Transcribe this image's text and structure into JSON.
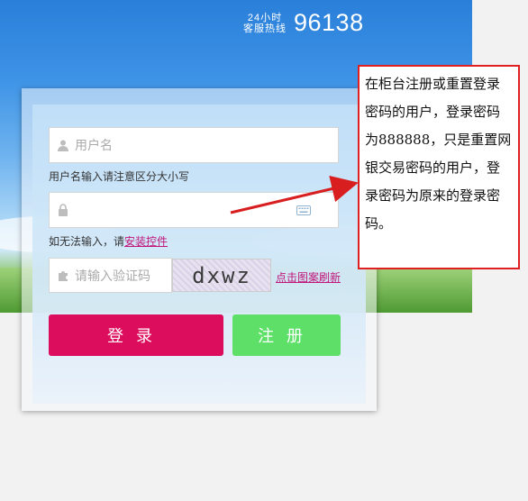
{
  "hotline": {
    "label_line1": "24小时",
    "label_line2": "客服热线",
    "number": "96138"
  },
  "form": {
    "username_placeholder": "用户名",
    "username_hint": "用户名输入请注意区分大小写",
    "password_placeholder": "",
    "password_hint_prefix": "如无法输入，请",
    "password_hint_link": "安装控件",
    "captcha_placeholder": "请输入验证码",
    "captcha_text": "dxwz",
    "captcha_refresh": "点击图案刷新",
    "login_button": "登录",
    "register_button": "注册"
  },
  "callout": {
    "text": "在柜台注册或重置登录密码的用户，登录密码为888888，只是重置网银交易密码的用户，登录密码为原来的登录密码。"
  },
  "colors": {
    "login_button": "#dc0d5c",
    "register_button": "#5ee068",
    "link": "#c0157a",
    "callout_border": "#e02020"
  }
}
